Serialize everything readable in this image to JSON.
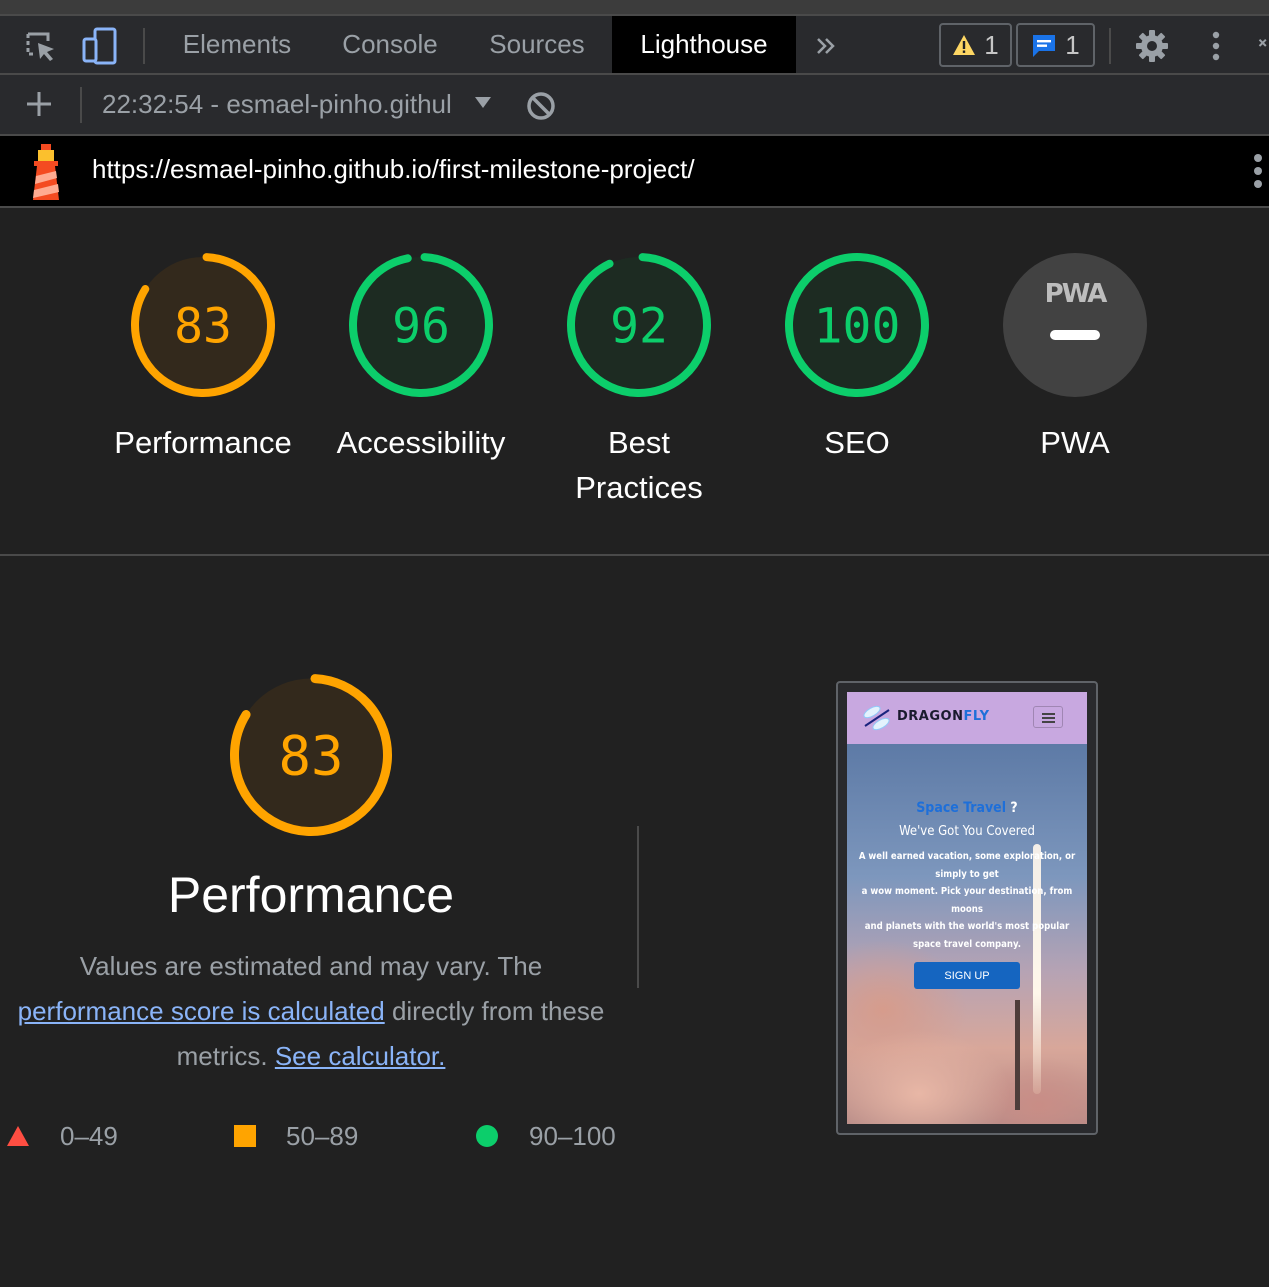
{
  "devtools": {
    "tabs": [
      {
        "label": "Elements"
      },
      {
        "label": "Console"
      },
      {
        "label": "Sources"
      },
      {
        "label": "Lighthouse"
      }
    ],
    "warning_count": "1",
    "message_count": "1",
    "icons": [
      "inspect-element-icon",
      "device-toolbar-icon",
      "more-tabs-icon",
      "warning-icon",
      "message-icon",
      "gear-icon",
      "kebab-menu-icon"
    ]
  },
  "lighthouse_toolbar": {
    "report_label": "22:32:54 - esmael-pinho.githul",
    "icons": [
      "add-icon",
      "dropdown-arrow-icon",
      "clear-icon"
    ]
  },
  "url_bar": {
    "url": "https://esmael-pinho.github.io/first-milestone-project/"
  },
  "scores": [
    {
      "label": "Performance",
      "score": "83",
      "value": 83,
      "rating": "average"
    },
    {
      "label": "Accessibility",
      "score": "96",
      "value": 96,
      "rating": "pass"
    },
    {
      "label": "Best Practices",
      "score": "92",
      "value": 92,
      "rating": "pass"
    },
    {
      "label": "SEO",
      "score": "100",
      "value": 100,
      "rating": "pass"
    },
    {
      "label": "PWA",
      "badge": "PWA",
      "score": "",
      "value": null,
      "rating": "na"
    }
  ],
  "performance": {
    "score": "83",
    "value": 83,
    "title": "Performance",
    "desc_part1": "Values are estimated and may vary. The",
    "desc_link1": "performance score is calculated",
    "desc_part2": "directly from these metrics.",
    "desc_link2": "See calculator."
  },
  "legend": [
    {
      "range": "0–49",
      "shape": "triangle"
    },
    {
      "range": "50–89",
      "shape": "square"
    },
    {
      "range": "90–100",
      "shape": "circle"
    }
  ],
  "screenshot": {
    "brand_part1": "DRAGON",
    "brand_part2": "FLY",
    "headline_part1": "Space Travel",
    "headline_part2": " ?",
    "subheadline": "We've Got You Covered",
    "body_lines": [
      "A well earned vacation, some exploration, or",
      "simply to get",
      "a wow moment. Pick your destination, from",
      "moons",
      "and planets with the world's most popular",
      "space travel company."
    ],
    "cta": "SIGN UP"
  },
  "colors": {
    "average": "#ffa400",
    "average_bg": "#33291c",
    "pass": "#0cce6b",
    "pass_bg": "#1d2b22",
    "fail": "#ff4e42",
    "na_bg": "#424242",
    "link": "#8ab4f8"
  }
}
